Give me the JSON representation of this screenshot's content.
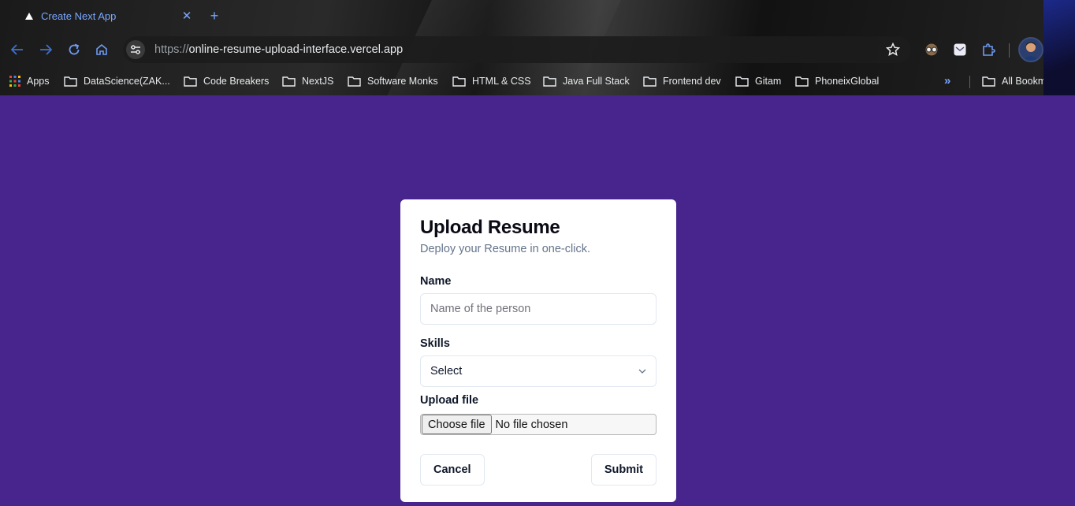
{
  "browser": {
    "tab": {
      "title": "Create Next App",
      "close_icon": "close-icon"
    },
    "new_tab_label": "+",
    "address": {
      "scheme": "https://",
      "host": "online-resume-upload-interface.vercel.app"
    },
    "bookmarks": [
      {
        "label": "Apps",
        "icon": "apps-grid-icon"
      },
      {
        "label": "DataScience(ZAK...",
        "icon": "folder-icon"
      },
      {
        "label": "Code Breakers",
        "icon": "folder-icon"
      },
      {
        "label": "NextJS",
        "icon": "folder-icon"
      },
      {
        "label": "Software Monks",
        "icon": "folder-icon"
      },
      {
        "label": "HTML & CSS",
        "icon": "folder-icon"
      },
      {
        "label": "Java Full Stack",
        "icon": "folder-icon"
      },
      {
        "label": "Frontend dev",
        "icon": "folder-icon"
      },
      {
        "label": "Gitam",
        "icon": "folder-icon"
      },
      {
        "label": "PhoneixGlobal",
        "icon": "folder-icon"
      }
    ],
    "more_bookmarks": "»",
    "all_bookmarks": "All Bookmarks",
    "accent_color": "#7aa7ff"
  },
  "page": {
    "background": "#47258d",
    "form": {
      "title": "Upload Resume",
      "description": "Deploy your Resume in one-click.",
      "name_label": "Name",
      "name_placeholder": "Name of the person",
      "skills_label": "Skills",
      "skills_value": "Select",
      "upload_label": "Upload file",
      "file_button": "Choose file",
      "file_status": "No file chosen",
      "cancel": "Cancel",
      "submit": "Submit"
    }
  }
}
